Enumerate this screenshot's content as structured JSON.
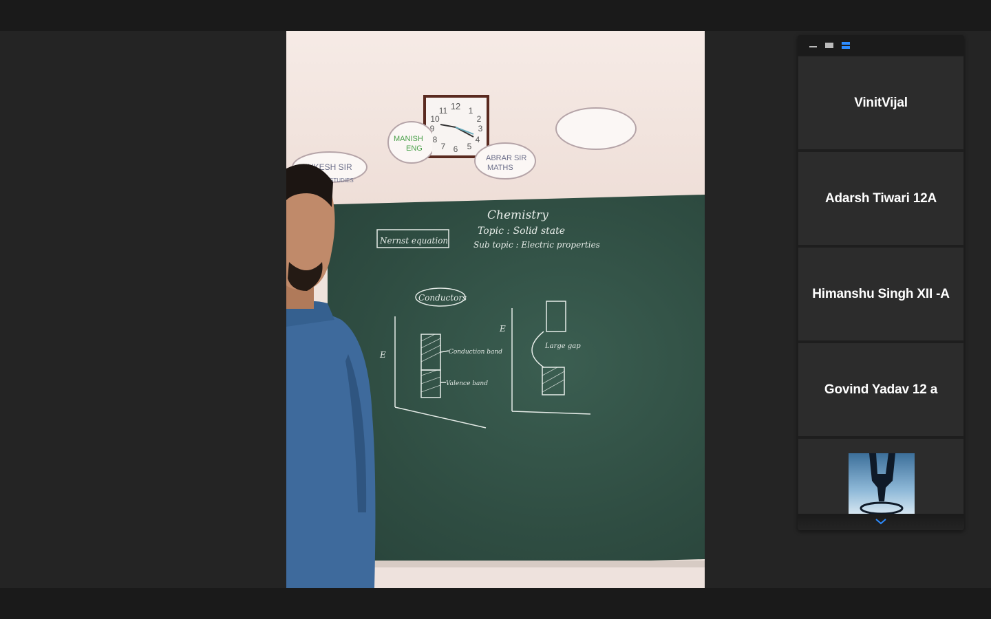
{
  "layout_controls": [
    "minimize-layout",
    "speaker-layout",
    "gallery-layout"
  ],
  "colors": {
    "accent": "#2d8cff",
    "tile_bg": "#2c2c2c",
    "background": "#242424"
  },
  "video": {
    "clock_numbers": [
      "12",
      "1",
      "2",
      "3",
      "4",
      "5",
      "6",
      "7",
      "8",
      "9",
      "10",
      "11"
    ],
    "wall_labels": [
      {
        "line1": "MUKESH SIR",
        "line2": "STUDIES"
      },
      {
        "line1": "MANISH",
        "line2": "ENG"
      },
      {
        "line1": "ABRAR SIR",
        "line2": "MATHS"
      },
      {
        "line1": "",
        "line2": ""
      }
    ],
    "board": {
      "heading": "Chemistry",
      "topic": "Topic : Solid state",
      "subtopic": "Sub topic : Electric properties",
      "box_label": "Nernst equation",
      "conductors": "Conductors",
      "axis_e": "E",
      "conduction_band": "Conduction band",
      "valence_band": "Valence band",
      "large_gap": "Large gap"
    }
  },
  "participants": [
    {
      "name": "VinitVijal"
    },
    {
      "name": "Adarsh Tiwari 12A"
    },
    {
      "name": "Himanshu Singh XII -A"
    },
    {
      "name": "Govind Yadav 12 a"
    },
    {
      "name": ""
    }
  ]
}
